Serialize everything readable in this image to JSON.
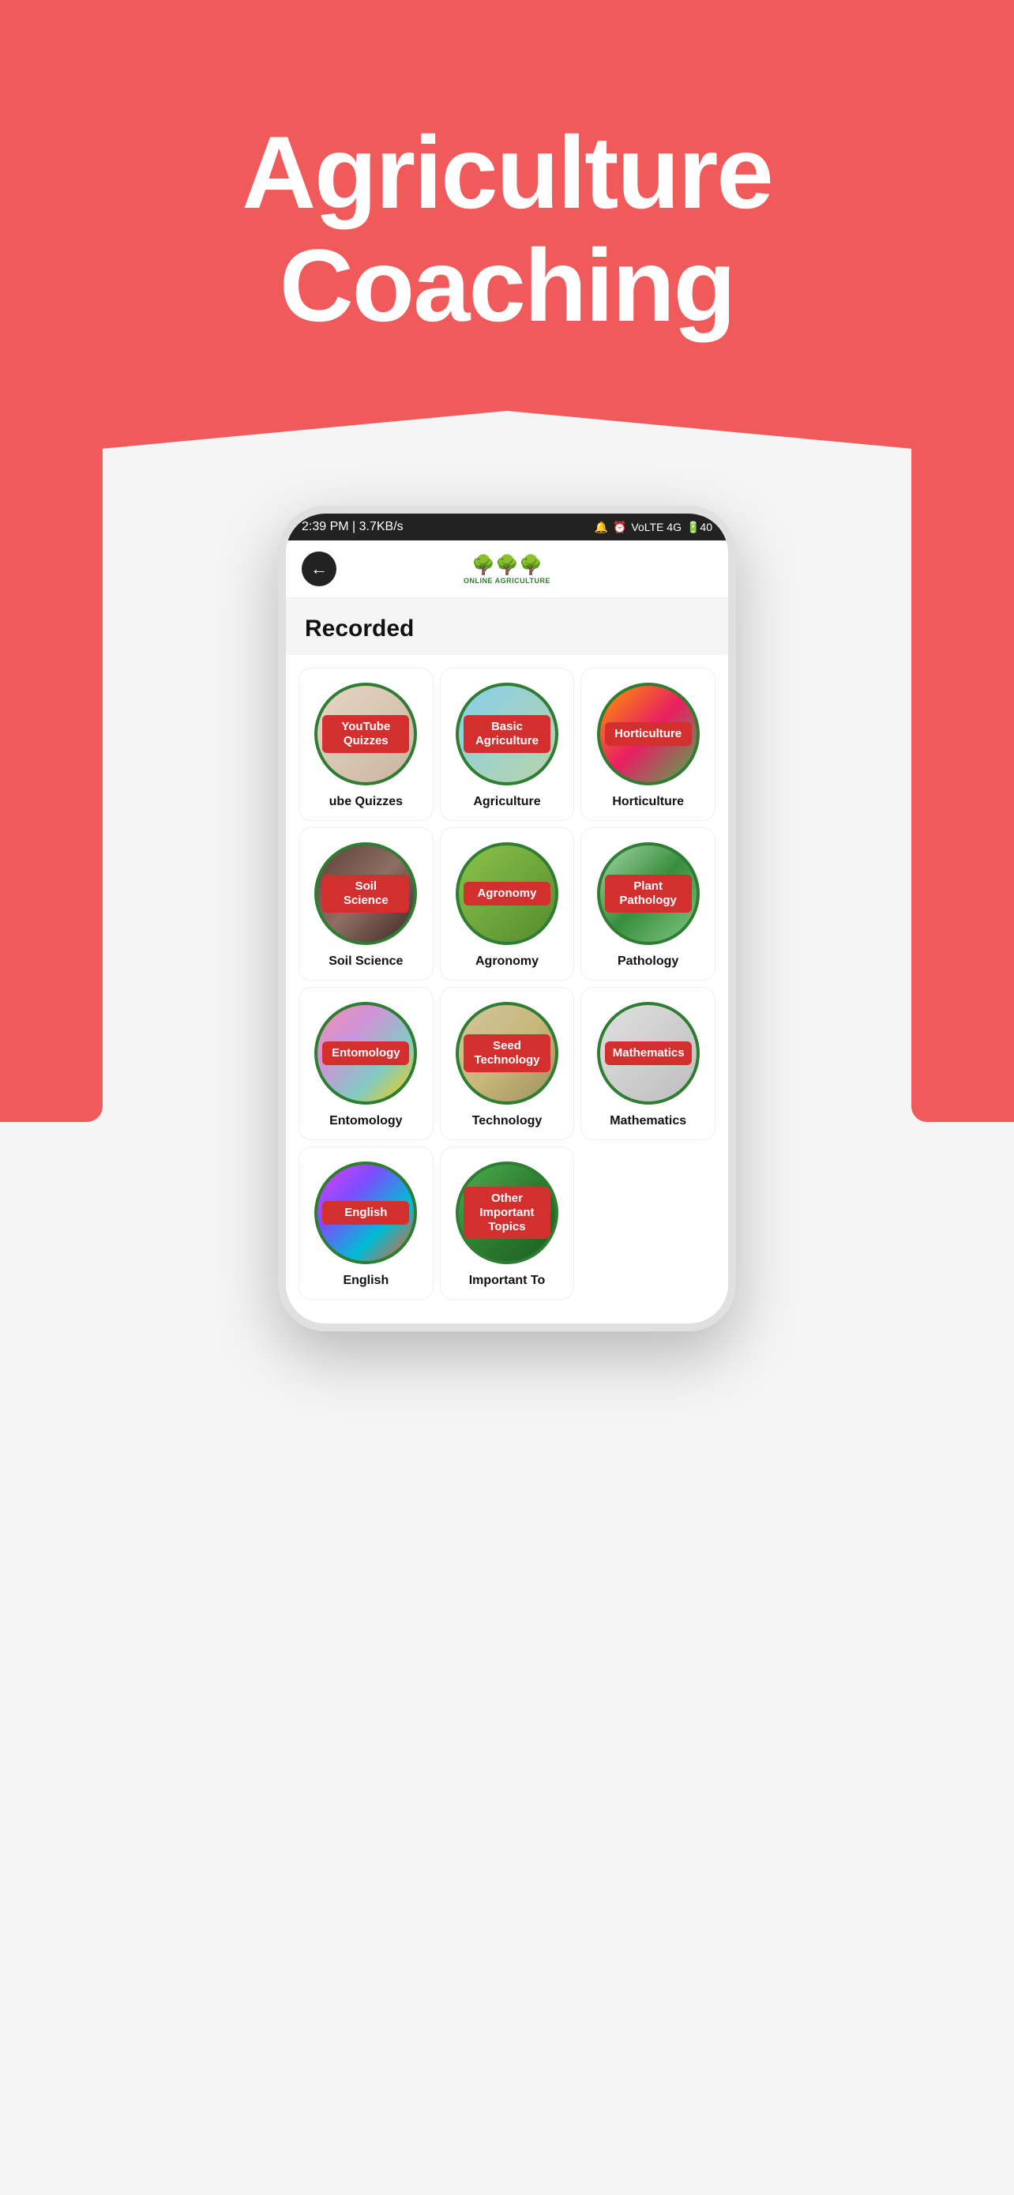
{
  "header": {
    "title_line1": "Agriculture",
    "title_line2": "Coaching"
  },
  "status_bar": {
    "time": "2:39 PM | 3.7KB/s",
    "icons": "🔔 ⏰",
    "network": "VoLTE 4G",
    "battery": "40"
  },
  "app_header": {
    "back_arrow": "←",
    "logo_icon": "🌳",
    "logo_text": "ONLINE AGRICULTURE"
  },
  "page_title": "Recorded",
  "categories": [
    {
      "id": "youtube-quizzes",
      "label": "YouTube\nQuizzes",
      "name": "ube Quizzes",
      "bg": "bg-youtube"
    },
    {
      "id": "basic-agriculture",
      "label": "Basic\nAgriculture",
      "name": "Agriculture",
      "bg": "bg-agriculture"
    },
    {
      "id": "horticulture",
      "label": "Horticulture",
      "name": "Horticulture",
      "bg": "bg-horticulture"
    },
    {
      "id": "soil-science",
      "label": "Soil\nScience",
      "name": "Soil Science",
      "bg": "bg-soil"
    },
    {
      "id": "agronomy",
      "label": "Agronomy",
      "name": "Agronomy",
      "bg": "bg-agronomy"
    },
    {
      "id": "plant-pathology",
      "label": "Plant\nPathology",
      "name": "Pathology",
      "bg": "bg-pathology"
    },
    {
      "id": "entomology",
      "label": "Entomology",
      "name": "Entomology",
      "bg": "bg-entomology"
    },
    {
      "id": "seed-technology",
      "label": "Seed\nTechnology",
      "name": "Technology",
      "bg": "bg-seed"
    },
    {
      "id": "mathematics",
      "label": "Mathematics",
      "name": "Mathematics",
      "bg": "bg-mathematics"
    },
    {
      "id": "english",
      "label": "English",
      "name": "English",
      "bg": "bg-english"
    },
    {
      "id": "other-important",
      "label": "Other Important\nTopics",
      "name": "Important To",
      "bg": "bg-other"
    }
  ]
}
